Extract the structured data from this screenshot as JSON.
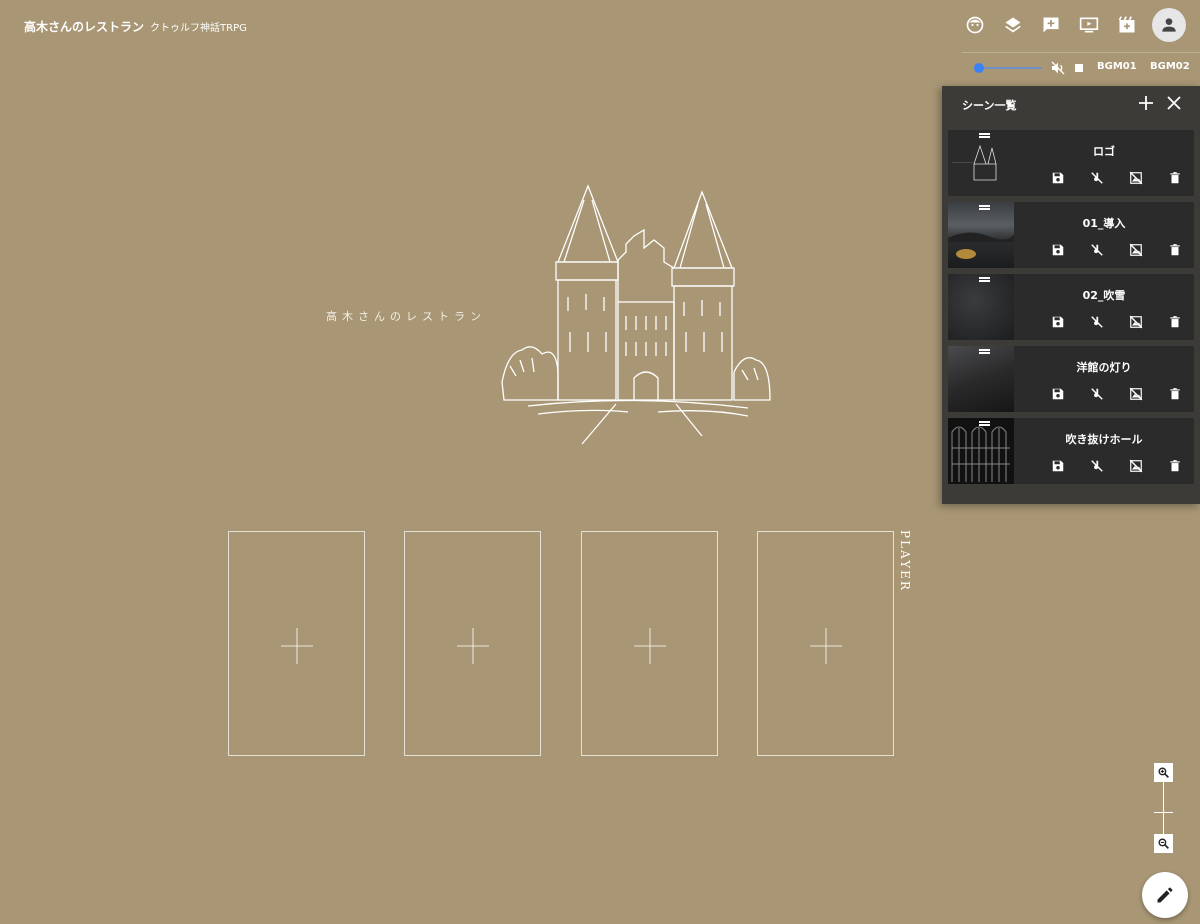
{
  "header": {
    "title": "高木さんのレストラン",
    "subtitle": "クトゥルフ神話TRPG"
  },
  "toolbar": {
    "icons": [
      "face-icon",
      "layers-icon",
      "add-comment-icon",
      "screen-icon",
      "scene-movie-icon",
      "account-icon"
    ]
  },
  "bgm": {
    "volume": 0.05,
    "buttons": [
      "BGM01",
      "BGM02"
    ]
  },
  "scene_panel": {
    "title": "シーン一覧",
    "scenes": [
      {
        "name": "ロゴ"
      },
      {
        "name": "01_導入"
      },
      {
        "name": "02_吹雪"
      },
      {
        "name": "洋館の灯り"
      },
      {
        "name": "吹き抜けホール"
      }
    ]
  },
  "stage": {
    "logo_text": "高木さんのレストラン",
    "player_label": "PLAYER",
    "player_slots": 4
  },
  "colors": {
    "background": "#a89674",
    "panel": "#3d3b38",
    "row": "#2b2b2b",
    "accent": "#3b82f6"
  }
}
